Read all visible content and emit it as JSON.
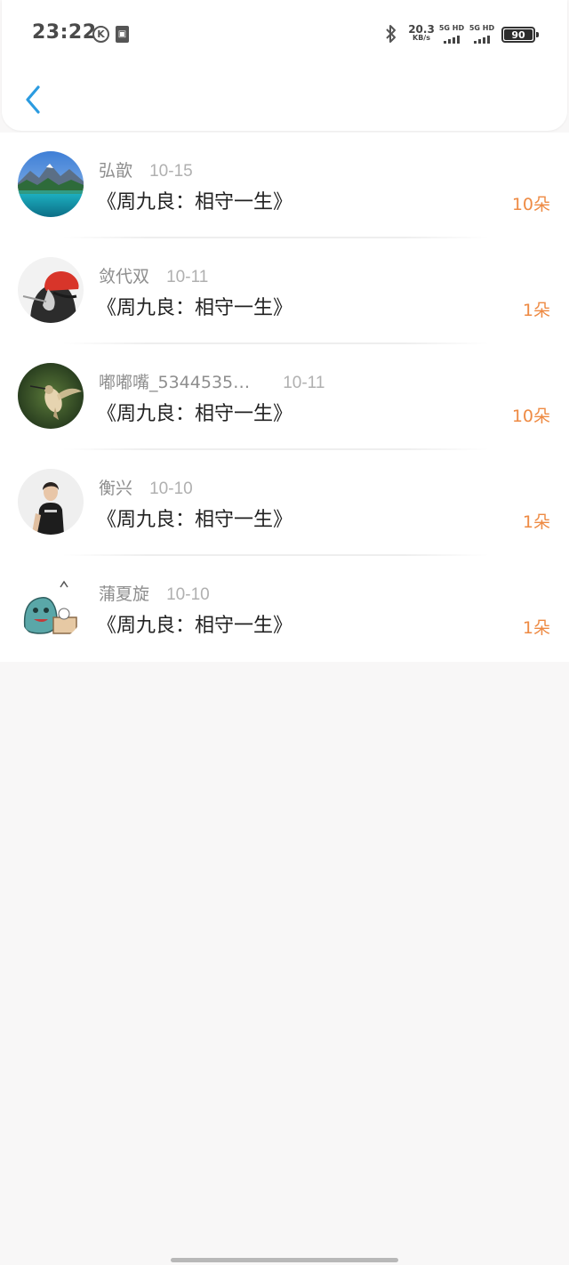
{
  "status_bar": {
    "time": "23:22",
    "k_badge": "K",
    "net_speed": "20.3",
    "net_speed_unit": "KB/s",
    "sim1": "5G HD",
    "sim2": "5G HD",
    "battery": "90",
    "icons": [
      "k-icon",
      "sim-card-icon",
      "bluetooth-icon",
      "signal-icon",
      "battery-icon"
    ]
  },
  "nav": {
    "back_icon": "chevron-left-icon",
    "accent": "#2b9be0"
  },
  "colors": {
    "amount": "#ee8a43",
    "meta": "#8e8e8e",
    "title": "#222222"
  },
  "records": [
    {
      "name": "弘歆",
      "date": "10-15",
      "title": "《周九良：相守一生》",
      "amount": "10朵"
    },
    {
      "name": "敛代双",
      "date": "10-11",
      "title": "《周九良：相守一生》",
      "amount": "1朵"
    },
    {
      "name": "嘟嘟嘴_5344535…",
      "date": "10-11",
      "title": "《周九良：相守一生》",
      "amount": "10朵"
    },
    {
      "name": "衡兴",
      "date": "10-10",
      "title": "《周九良：相守一生》",
      "amount": "1朵"
    },
    {
      "name": "蒲夏旋",
      "date": "10-10",
      "title": "《周九良：相守一生》",
      "amount": "1朵"
    }
  ]
}
